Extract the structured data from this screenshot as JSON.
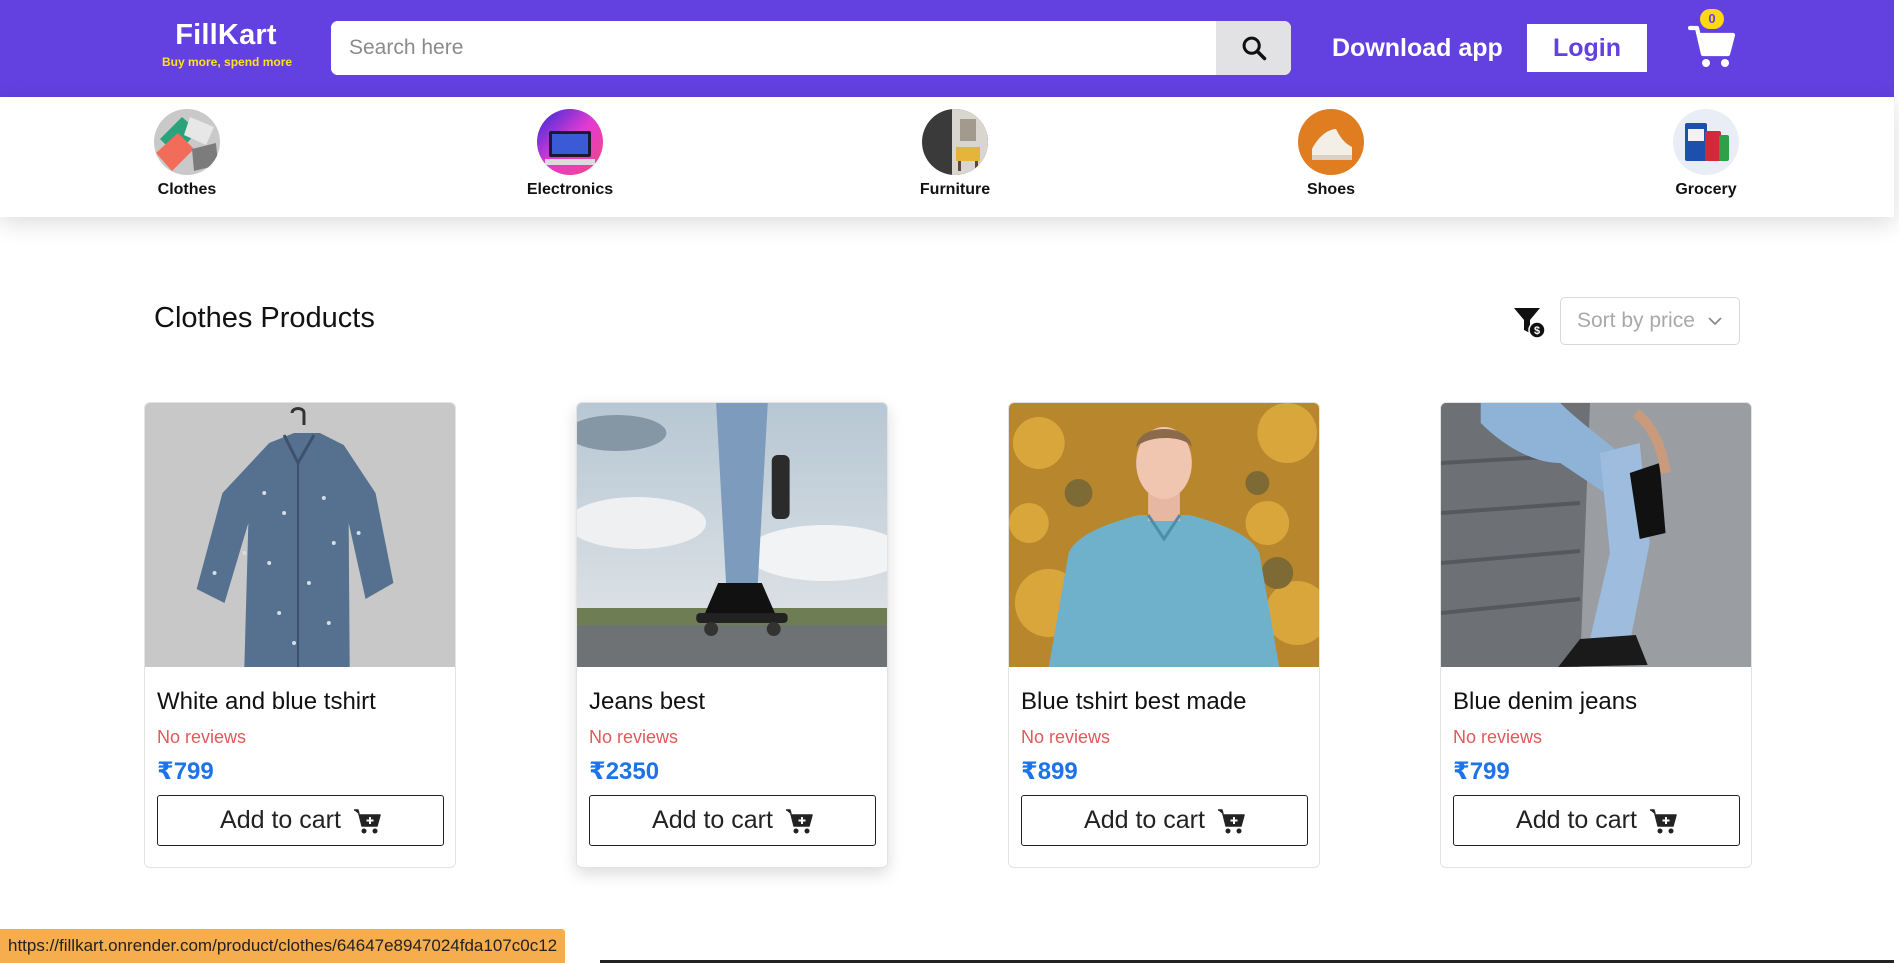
{
  "colors": {
    "header_bg": "#6241e0",
    "tagline": "#ffe11b",
    "price": "#1c74e8",
    "reviews": "#e05a5a",
    "badge": "#ffd814",
    "status_bar": "#f5ad4d"
  },
  "header": {
    "brand_name": "FillKart",
    "brand_tagline": "Buy more, spend more",
    "search_placeholder": "Search here",
    "search_icon": "search-icon",
    "download_label": "Download app",
    "login_label": "Login",
    "cart_icon": "cart-icon",
    "cart_count": "0"
  },
  "categories": [
    {
      "label": "Clothes",
      "icon": "clothes-icon"
    },
    {
      "label": "Electronics",
      "icon": "electronics-icon"
    },
    {
      "label": "Furniture",
      "icon": "furniture-icon"
    },
    {
      "label": "Shoes",
      "icon": "shoes-icon"
    },
    {
      "label": "Grocery",
      "icon": "grocery-icon"
    }
  ],
  "section": {
    "title": "Clothes Products",
    "filter_icon": "filter-price-icon",
    "sort_label": "Sort by price"
  },
  "products": [
    {
      "title": "White and blue tshirt",
      "reviews": "No reviews",
      "price": "₹799",
      "button": "Add to cart"
    },
    {
      "title": "Jeans best",
      "reviews": "No reviews",
      "price": "₹2350",
      "button": "Add to cart"
    },
    {
      "title": "Blue tshirt best made",
      "reviews": "No reviews",
      "price": "₹899",
      "button": "Add to cart"
    },
    {
      "title": "Blue denim jeans",
      "reviews": "No reviews",
      "price": "₹799",
      "button": "Add to cart"
    }
  ],
  "status_url": "https://fillkart.onrender.com/product/clothes/64647e8947024fda107c0c12"
}
